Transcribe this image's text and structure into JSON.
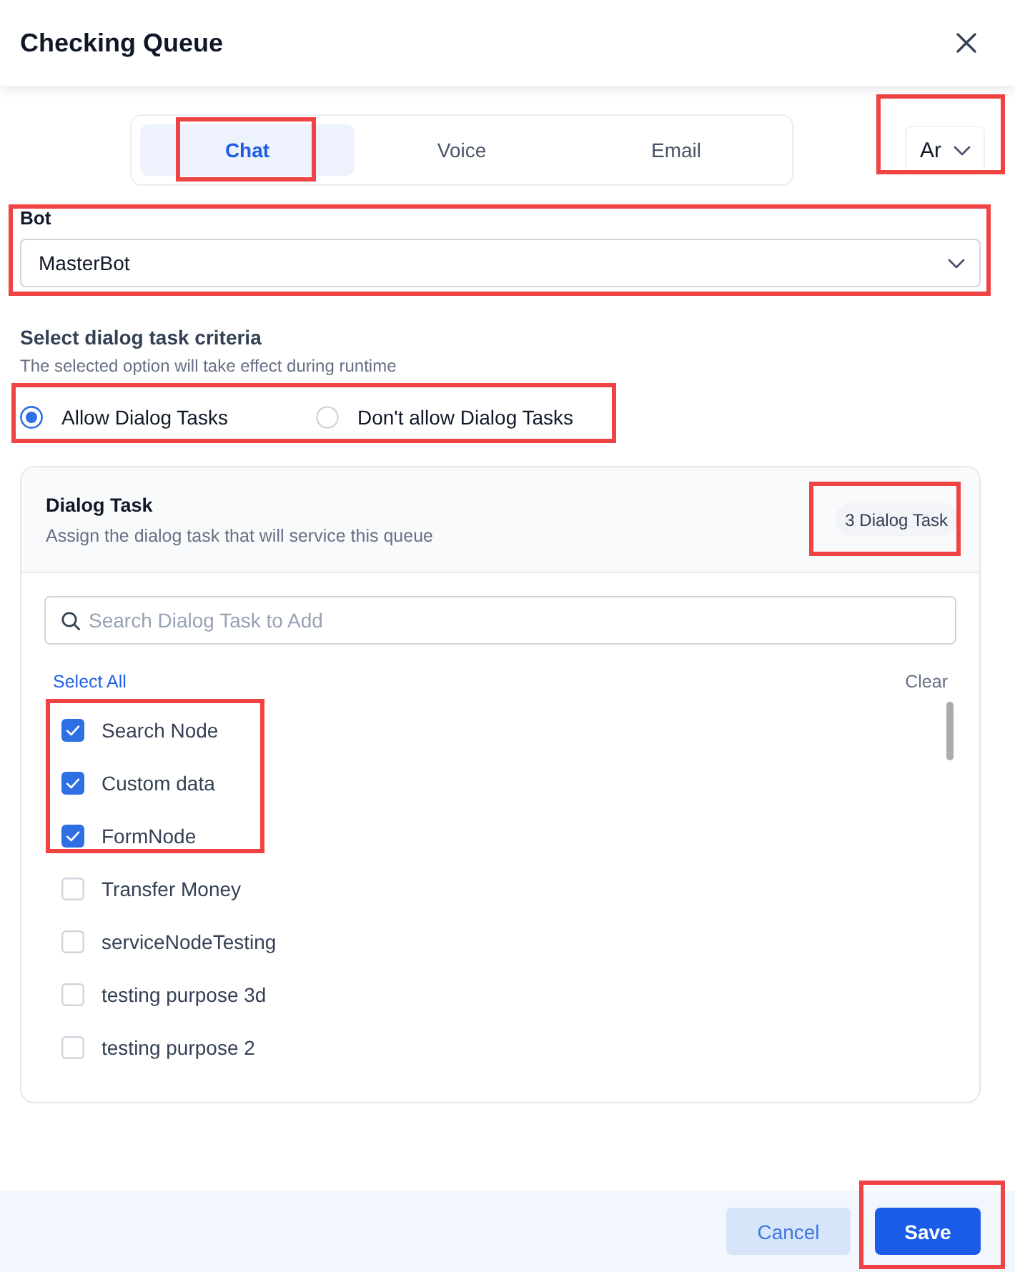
{
  "dialog": {
    "title": "Checking Queue"
  },
  "channel_tabs": [
    {
      "label": "Chat",
      "selected": true,
      "highlighted": true
    },
    {
      "label": "Voice",
      "selected": false,
      "highlighted": false
    },
    {
      "label": "Email",
      "selected": false,
      "highlighted": false
    }
  ],
  "language_select": {
    "value": "Ar",
    "highlighted": true
  },
  "bot": {
    "label": "Bot",
    "value": "MasterBot",
    "highlighted": true
  },
  "criteria": {
    "title": "Select dialog task criteria",
    "description": "The selected option will take effect during runtime",
    "highlighted": true,
    "options": [
      {
        "label": "Allow Dialog Tasks",
        "selected": true
      },
      {
        "label": "Don't allow Dialog Tasks",
        "selected": false
      }
    ]
  },
  "dialog_task": {
    "title": "Dialog Task",
    "description": "Assign the dialog task that will service this queue",
    "count_badge": {
      "text": "3 Dialog Task",
      "highlighted": true
    },
    "search": {
      "placeholder": "Search Dialog Task to Add"
    },
    "select_all": "Select All",
    "clear": "Clear",
    "tasks": [
      {
        "label": "Search Node",
        "checked": true,
        "highlighted": true
      },
      {
        "label": "Custom data",
        "checked": true,
        "highlighted": true
      },
      {
        "label": "FormNode",
        "checked": true,
        "highlighted": true
      },
      {
        "label": "Transfer Money",
        "checked": false,
        "highlighted": false
      },
      {
        "label": "serviceNodeTesting",
        "checked": false,
        "highlighted": false
      },
      {
        "label": "testing purpose 3d",
        "checked": false,
        "highlighted": false
      },
      {
        "label": "testing purpose 2",
        "checked": false,
        "highlighted": false
      }
    ]
  },
  "buttons": [
    {
      "label": "Cancel",
      "kind": "secondary",
      "highlighted": false
    },
    {
      "label": "Save",
      "kind": "primary",
      "highlighted": true
    }
  ]
}
